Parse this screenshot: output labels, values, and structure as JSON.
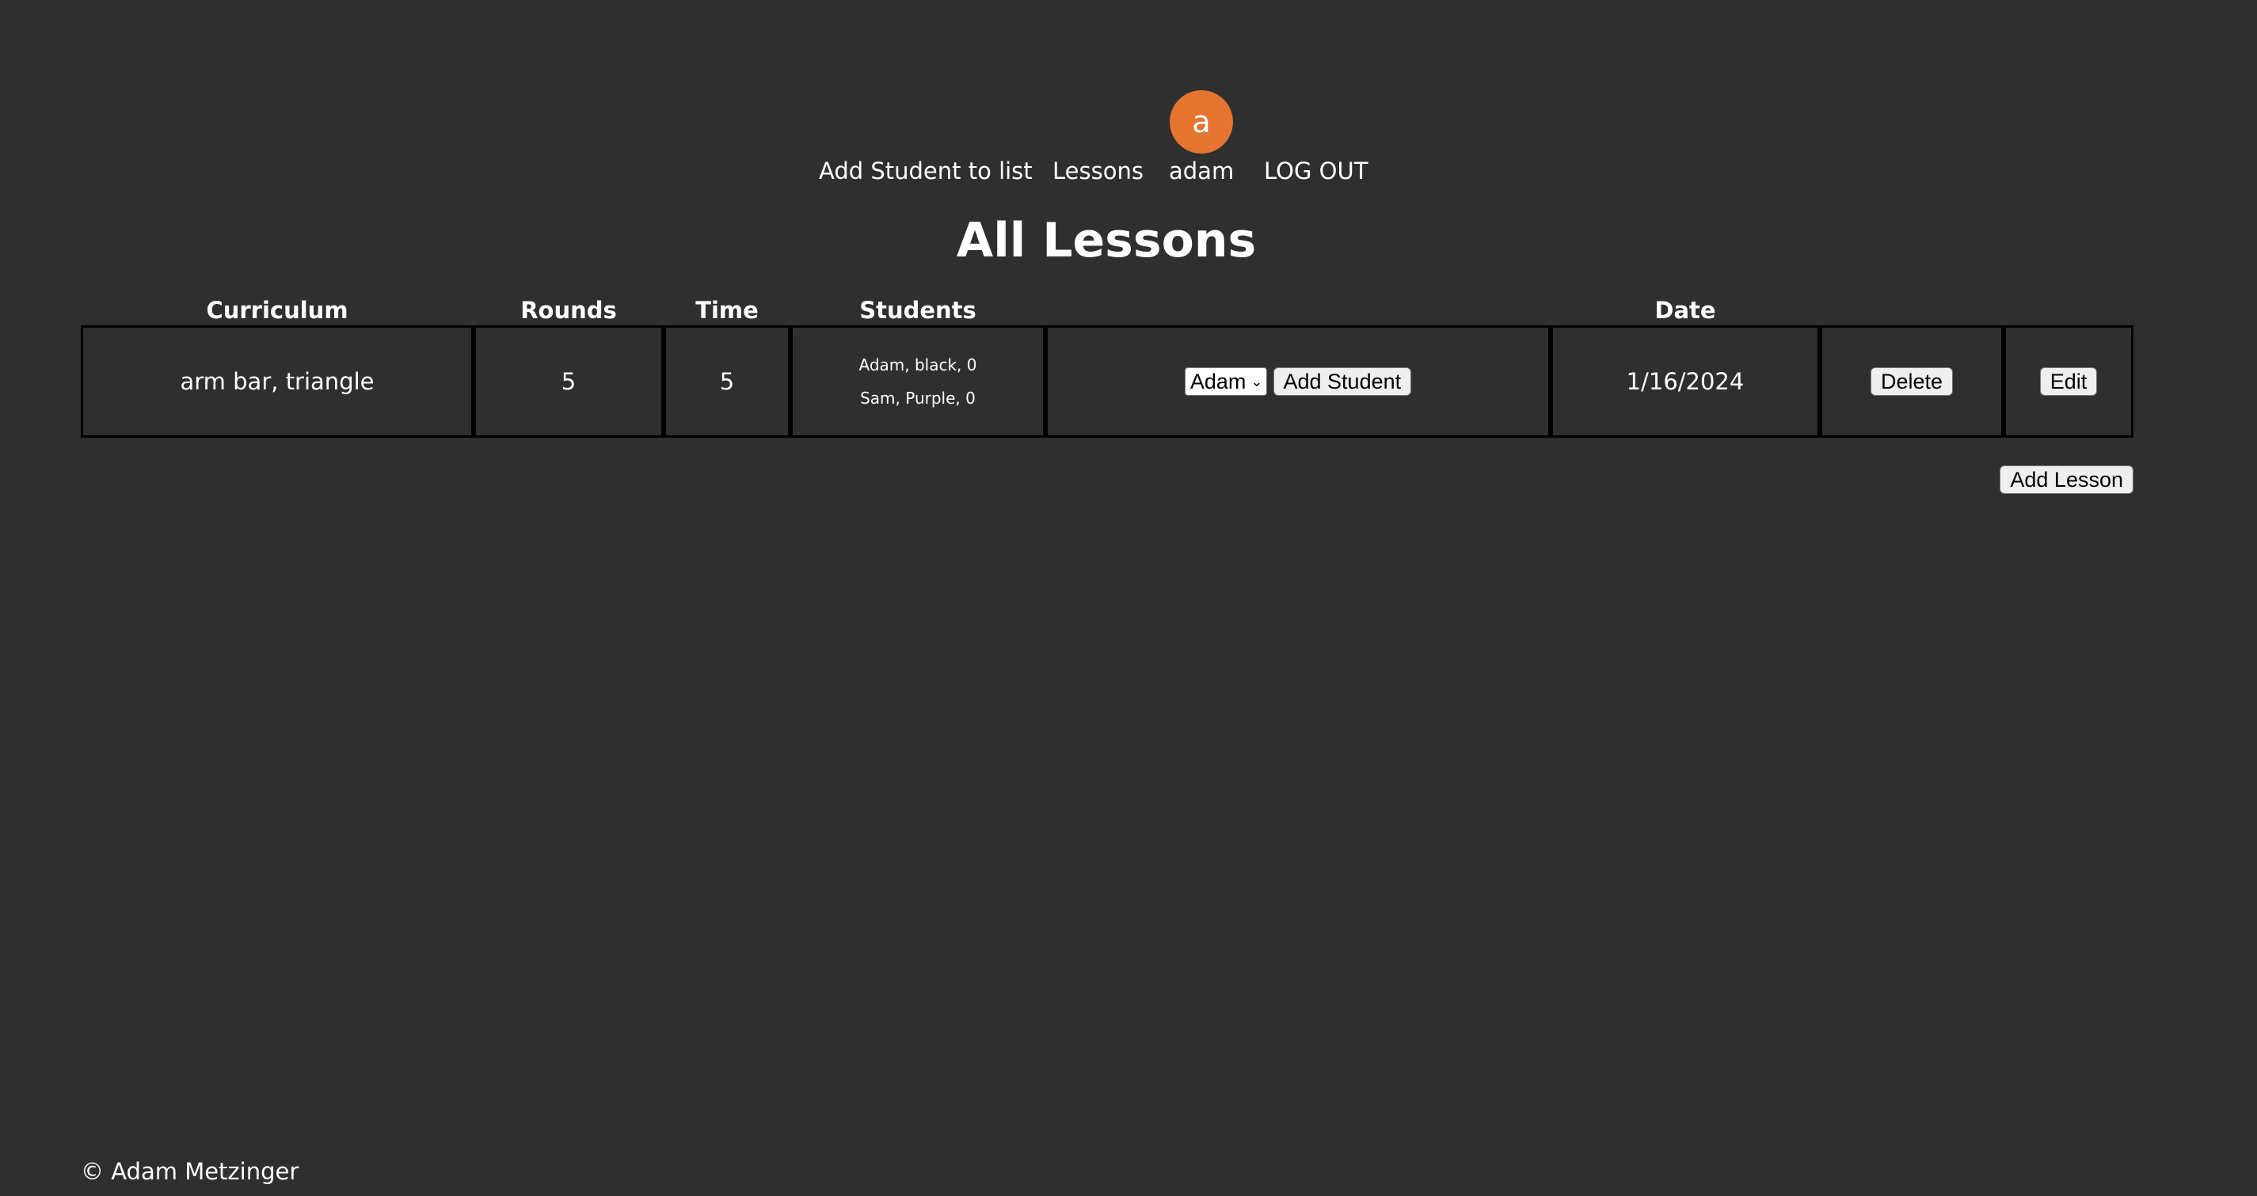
{
  "nav": {
    "avatar_letter": "a",
    "add_student_label": "Add Student to list",
    "lessons_label": "Lessons",
    "username": "adam",
    "logout_label": "LOG OUT"
  },
  "page_title": "All Lessons",
  "table": {
    "headers": {
      "curriculum": "Curriculum",
      "rounds": "Rounds",
      "time": "Time",
      "students": "Students",
      "date": "Date"
    },
    "rows": [
      {
        "curriculum": "arm bar, triangle",
        "rounds": "5",
        "time": "5",
        "students": [
          "Adam, black, 0",
          "Sam, Purple, 0"
        ],
        "student_select_value": "Adam",
        "add_student_label": "Add Student",
        "date": "1/16/2024",
        "delete_label": "Delete",
        "edit_label": "Edit"
      }
    ]
  },
  "add_lesson_label": "Add Lesson",
  "footer": "© Adam Metzinger"
}
